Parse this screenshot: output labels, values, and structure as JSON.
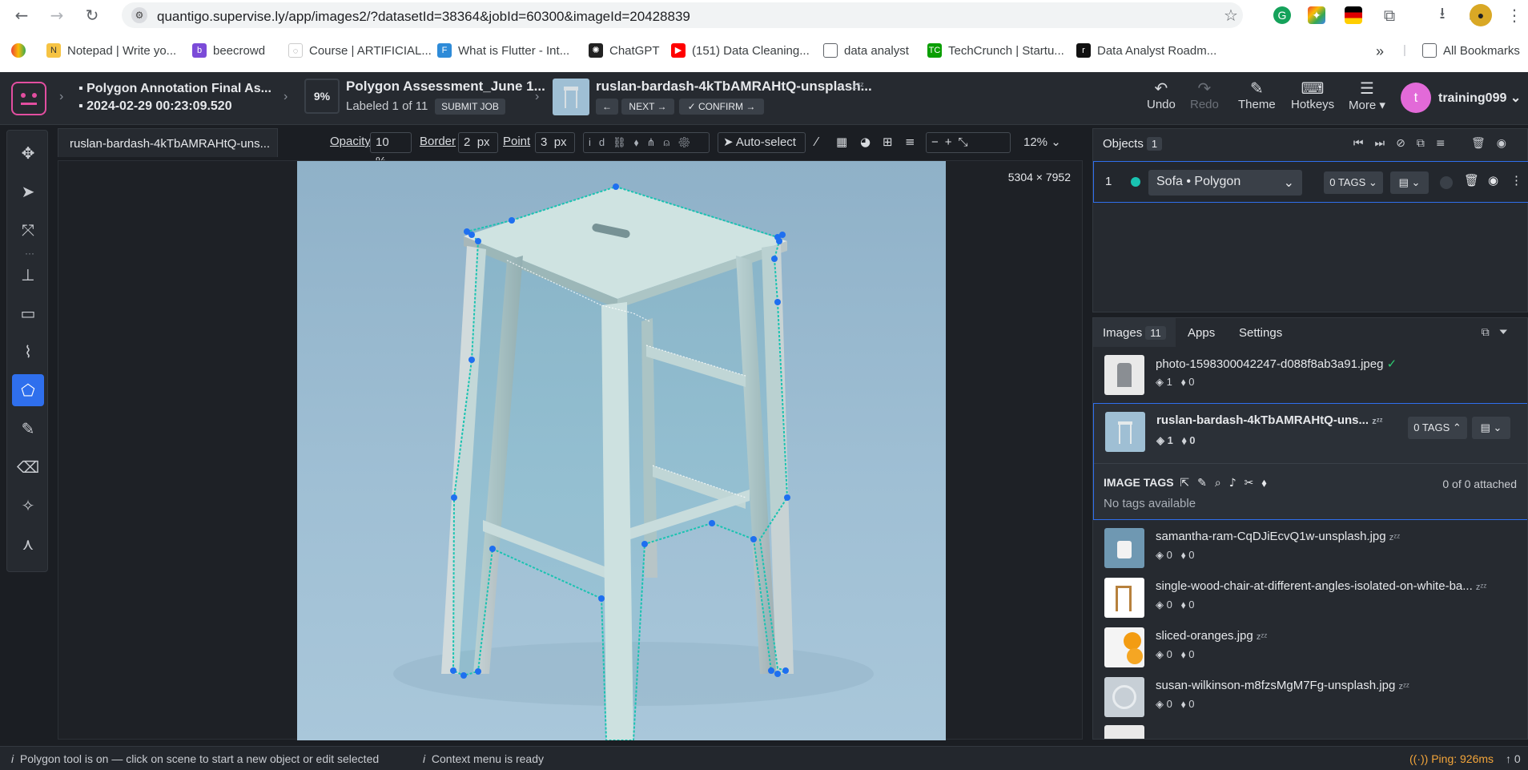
{
  "browser": {
    "url": "quantigo.supervise.ly/app/images2/?datasetId=38364&jobId=60300&imageId=20428839",
    "bookmarks": [
      "Notepad | Write yo...",
      "beecrowd",
      "Course | ARTIFICIAL...",
      "What is Flutter - Int...",
      "ChatGPT",
      "(151) Data Cleaning...",
      "data analyst",
      "TechCrunch | Startu...",
      "Data Analyst Roadm..."
    ],
    "all_bookmarks": "All Bookmarks"
  },
  "header": {
    "project_title": "Polygon Annotation Final As...",
    "project_date": "2024-02-29 00:23:09.520",
    "progress": "9%",
    "job_title": "Polygon Assessment_June 1...",
    "labeled": "Labeled 1 of 11",
    "submit": "SUBMIT JOB",
    "image_title": "ruslan-bardash-4kTbAMRAHtQ-unsplash...",
    "zzz": "zᶻᶻ",
    "next": "NEXT",
    "confirm": "CONFIRM",
    "undo": "Undo",
    "redo": "Redo",
    "theme": "Theme",
    "hotkeys": "Hotkeys",
    "more": "More",
    "avatar_letter": "t",
    "user": "training099"
  },
  "canvas": {
    "tab": "ruslan-bardash-4kTbAMRAHtQ-uns...",
    "opacity_label": "Opacity",
    "opacity_value": "10",
    "opacity_unit": "%",
    "border_label": "Border",
    "border_value": "2",
    "border_unit": "px",
    "point_label": "Point",
    "point_value": "3",
    "point_unit": "px",
    "id_label": "id",
    "auto_select": "Auto-select",
    "zoom": "12%",
    "dimensions": "5304 × 7952"
  },
  "objects": {
    "title": "Objects",
    "count": "1",
    "row_index": "1",
    "class_label": "Sofa • Polygon",
    "tags": "0 TAGS"
  },
  "images": {
    "tabs": [
      "Images",
      "Apps",
      "Settings"
    ],
    "count": "11",
    "items": [
      {
        "name": "photo-1598300042247-d088f8ab3a91.jpeg",
        "objects": "1",
        "tags": "0",
        "check": "✓"
      },
      {
        "name": "ruslan-bardash-4kTbAMRAHtQ-uns...",
        "objects": "1",
        "tags": "0",
        "tag_btn": "0 TAGS"
      },
      {
        "name": "samantha-ram-CqDJiEcvQ1w-unsplash.jpg",
        "objects": "0",
        "tags": "0"
      },
      {
        "name": "single-wood-chair-at-different-angles-isolated-on-white-ba...",
        "objects": "0",
        "tags": "0"
      },
      {
        "name": "sliced-oranges.jpg",
        "objects": "0",
        "tags": "0"
      },
      {
        "name": "susan-wilkinson-m8fzsMgM7Fg-unsplash.jpg",
        "objects": "0",
        "tags": "0"
      }
    ],
    "image_tags_label": "IMAGE TAGS",
    "attached": "0 of 0 attached",
    "no_tags": "No tags available"
  },
  "status": {
    "polygon_msg": "Polygon tool is on — click on scene to start a new object or edit selected",
    "context_msg": "Context menu is ready",
    "ping": "Ping: 926ms",
    "right_count": "0"
  },
  "colors": {
    "accent": "#2f6fed",
    "polygon": "#19c3b1",
    "vertex": "#1e6ff0",
    "avatar": "#e26ad8",
    "ping": "#f3a53a"
  }
}
